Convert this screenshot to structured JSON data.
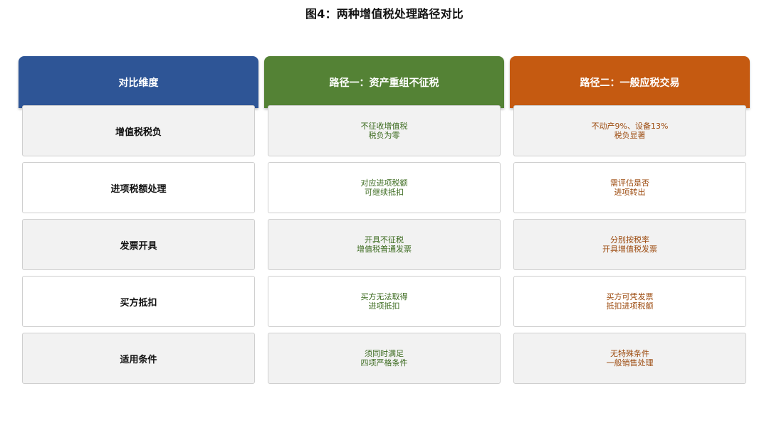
{
  "title": "图4：两种增值税处理路径对比",
  "headers": {
    "dimension": "对比维度",
    "path1": "路径一：资产重组不征税",
    "path2": "路径二：一般应税交易"
  },
  "rows": [
    {
      "dimension": "增值税税负",
      "path1": "不征收增值税\n税负为零",
      "path2": "不动产9%、设备13%\n税负显著"
    },
    {
      "dimension": "进项税额处理",
      "path1": "对应进项税额\n可继续抵扣",
      "path2": "需评估是否\n进项转出"
    },
    {
      "dimension": "发票开具",
      "path1": "开具不征税\n增值税普通发票",
      "path2": "分别按税率\n开具增值税发票"
    },
    {
      "dimension": "买方抵扣",
      "path1": "买方无法取得\n进项抵扣",
      "path2": "买方可凭发票\n抵扣进项税额"
    },
    {
      "dimension": "适用条件",
      "path1": "须同时满足\n四项严格条件",
      "path2": "无特殊条件\n一般销售处理"
    }
  ],
  "colors": {
    "dimension_header": "#2e5596",
    "path1_header": "#548235",
    "path2_header": "#c55a11",
    "path1_text": "#3b6a1e",
    "path2_text": "#9c4a0e"
  }
}
